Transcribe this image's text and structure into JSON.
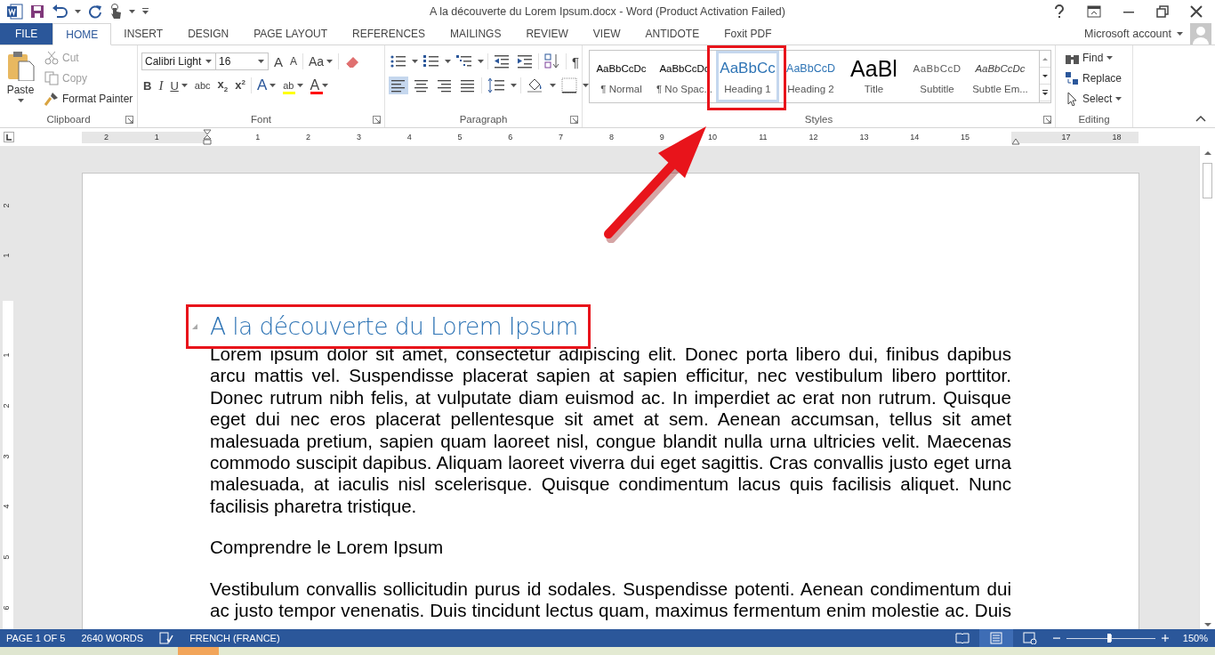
{
  "title_bar": {
    "title": "A la découverte du Lorem Ipsum.docx - Word (Product Activation Failed)"
  },
  "tabs": [
    {
      "label": "FILE",
      "kind": "file",
      "selected": false
    },
    {
      "label": "HOME",
      "kind": "tab",
      "selected": true
    },
    {
      "label": "INSERT",
      "kind": "tab",
      "selected": false
    },
    {
      "label": "DESIGN",
      "kind": "tab",
      "selected": false
    },
    {
      "label": "PAGE LAYOUT",
      "kind": "tab",
      "selected": false
    },
    {
      "label": "REFERENCES",
      "kind": "tab",
      "selected": false
    },
    {
      "label": "MAILINGS",
      "kind": "tab",
      "selected": false
    },
    {
      "label": "REVIEW",
      "kind": "tab",
      "selected": false
    },
    {
      "label": "VIEW",
      "kind": "tab",
      "selected": false
    },
    {
      "label": "ANTIDOTE",
      "kind": "tab",
      "selected": false
    },
    {
      "label": "Foxit PDF",
      "kind": "tab",
      "selected": false
    }
  ],
  "account": {
    "label": "Microsoft account"
  },
  "ribbon": {
    "clipboard": {
      "label": "Clipboard",
      "paste": "Paste",
      "commands": [
        {
          "label": "Cut",
          "kind": "cut",
          "disabled": true
        },
        {
          "label": "Copy",
          "kind": "copy",
          "disabled": true
        },
        {
          "label": "Format Painter",
          "kind": "painter",
          "disabled": false
        }
      ]
    },
    "font": {
      "label": "Font",
      "font_name": "Calibri Light",
      "font_size": "16",
      "row1_tools": [
        {
          "kind": "grow",
          "label": "A"
        },
        {
          "kind": "shrink",
          "label": "A"
        },
        {
          "kind": "case",
          "label": "Aa"
        }
      ],
      "row2_tools": [
        {
          "kind": "bold",
          "label": "B"
        },
        {
          "kind": "italic",
          "label": "I"
        },
        {
          "kind": "underline",
          "label": "U"
        },
        {
          "kind": "strike",
          "label": "abc"
        },
        {
          "kind": "sub",
          "label": "x$_{2}$"
        },
        {
          "kind": "sup",
          "label": "x$^{2}$"
        },
        {
          "kind": "effects",
          "label": "A"
        },
        {
          "kind": "highlight",
          "label": "ab",
          "color": "#ffff00"
        },
        {
          "kind": "color",
          "label": "A",
          "color": "#ff0000"
        }
      ]
    },
    "paragraph": {
      "label": "Paragraph",
      "show_marks": "¶",
      "alignment": [
        {
          "kind": "left",
          "selected": true
        },
        {
          "kind": "center",
          "selected": false
        },
        {
          "kind": "right",
          "selected": false
        },
        {
          "kind": "justify",
          "selected": false
        }
      ]
    },
    "styles": {
      "label": "Styles",
      "items": [
        {
          "preview": "AaBbCcDc",
          "label": "¶ Normal",
          "kind": "normal",
          "selected": false
        },
        {
          "preview": "AaBbCcDc",
          "label": "¶ No Spac...",
          "kind": "nospacing",
          "selected": false
        },
        {
          "preview": "AaBbCc",
          "label": "Heading 1",
          "kind": "heading1",
          "selected": true
        },
        {
          "preview": "AaBbCcD",
          "label": "Heading 2",
          "kind": "heading2",
          "selected": false
        },
        {
          "preview": "AaBl",
          "label": "Title",
          "kind": "title",
          "selected": false
        },
        {
          "preview": "AaBbCcD",
          "label": "Subtitle",
          "kind": "subtitle",
          "selected": false
        },
        {
          "preview": "AaBbCcDc",
          "label": "Subtle Em...",
          "kind": "emphasis",
          "selected": false
        }
      ]
    },
    "editing": {
      "label": "Editing",
      "commands": [
        {
          "label": "Find",
          "kind": "find"
        },
        {
          "label": "Replace",
          "kind": "replace"
        },
        {
          "label": "Select",
          "kind": "select"
        }
      ]
    }
  },
  "ruler": {
    "left_numbers": [
      "2",
      "1"
    ],
    "right_numbers": [
      "1",
      "2",
      "3",
      "4",
      "5",
      "6",
      "7",
      "8",
      "9",
      "10",
      "11",
      "12",
      "13",
      "14",
      "15",
      "17",
      "18"
    ]
  },
  "vertical_ruler": {
    "top_numbers": [
      "2",
      "1"
    ],
    "body_numbers": [
      "1",
      "2",
      "3",
      "4",
      "5",
      "6"
    ]
  },
  "document": {
    "blocks": [
      {
        "kind": "heading",
        "text": "A la découverte du Lorem Ipsum"
      },
      {
        "kind": "body",
        "text": "Lorem ipsum dolor sit amet, consectetur adipiscing elit. Donec porta libero dui, finibus dapibus arcu mattis vel. Suspendisse placerat sapien at sapien efficitur, nec vestibulum libero porttitor. Donec rutrum nibh felis, at vulputate diam euismod ac. In imperdiet ac erat non rutrum. Quisque eget dui nec eros placerat pellentesque sit amet at sem. Aenean accumsan, tellus sit amet malesuada pretium, sapien quam laoreet nisl, congue blandit nulla urna ultricies velit. Maecenas commodo suscipit dapibus. Aliquam laoreet viverra dui eget sagittis. Cras convallis justo eget urna malesuada, at iaculis nisl scelerisque. Quisque condimentum lacus quis facilisis aliquet. Nunc facilisis pharetra tristique."
      },
      {
        "kind": "subheading",
        "text": "Comprendre le Lorem Ipsum"
      },
      {
        "kind": "body_cut",
        "text": "Vestibulum convallis sollicitudin purus id sodales. Suspendisse potenti. Aenean condimentum dui ac justo tempor venenatis. Duis tincidunt lectus quam, maximus fermentum enim molestie ac. Duis"
      }
    ]
  },
  "status_bar": {
    "page": "PAGE 1 OF 5",
    "words": "2640 WORDS",
    "language": "FRENCH (FRANCE)",
    "zoom": "150%",
    "zoom_level": {
      "level": 0.48
    },
    "views": [
      {
        "kind": "read",
        "selected": false
      },
      {
        "kind": "print",
        "selected": true
      },
      {
        "kind": "web",
        "selected": false
      }
    ]
  }
}
